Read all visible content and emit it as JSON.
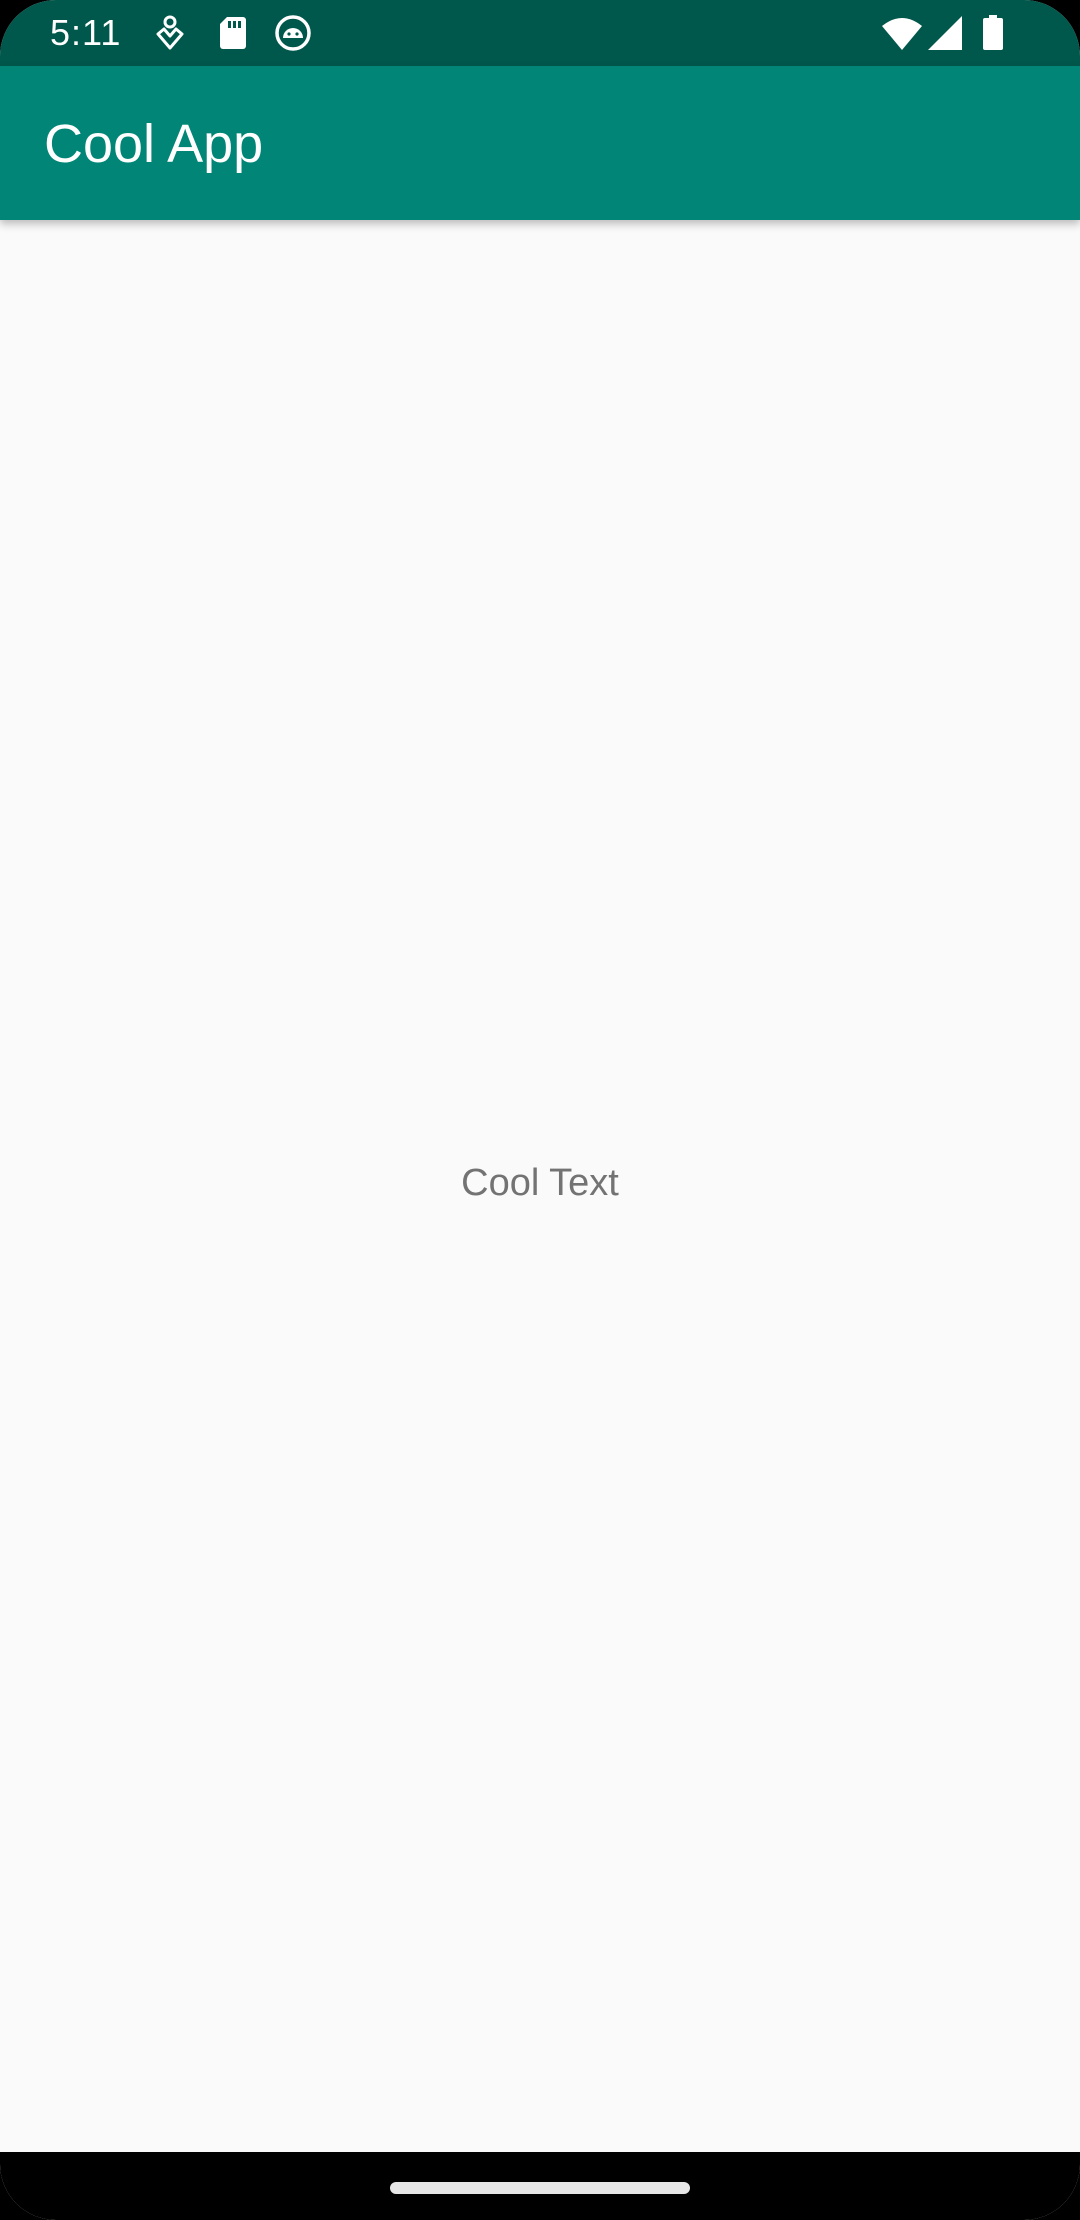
{
  "status_bar": {
    "time": "5:11",
    "left_icons": [
      "accessibility-icon",
      "sd-card-icon",
      "android-debug-icon"
    ],
    "right_icons": [
      "wifi-icon",
      "cell-signal-icon",
      "battery-icon"
    ],
    "background_color": "#00574b"
  },
  "app_bar": {
    "title": "Cool App",
    "background_color": "#008577"
  },
  "content": {
    "center_text": "Cool Text",
    "background_color": "#fafafa"
  },
  "navigation_bar": {
    "gesture_handle": "home-gesture-handle"
  }
}
